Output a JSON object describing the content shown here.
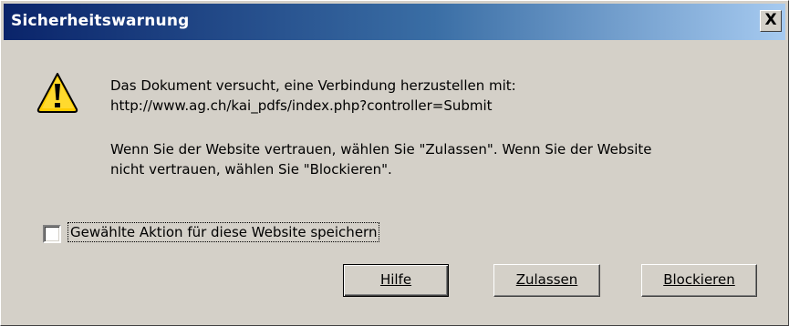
{
  "window": {
    "title": "Sicherheitswarnung",
    "close_label": "X"
  },
  "icons": {
    "warning": "warning-icon"
  },
  "message": {
    "line1": "Das Dokument versucht, eine Verbindung herzustellen mit:",
    "line2": "http://www.ag.ch/kai_pdfs/index.php?controller=Submit",
    "line3": "Wenn Sie der Website vertrauen, wählen Sie \"Zulassen\". Wenn Sie der Website",
    "line4": "nicht vertrauen, wählen Sie \"Blockieren\"."
  },
  "checkbox": {
    "label": "Gewählte Aktion für diese Website speichern",
    "checked": false
  },
  "buttons": {
    "help": "Hilfe",
    "allow": "Zulassen",
    "block": "Blockieren"
  },
  "colors": {
    "dialog_bg": "#d4d0c8",
    "title_start": "#0a246a",
    "title_end": "#a6caf0",
    "warning_yellow": "#ffcc00"
  }
}
